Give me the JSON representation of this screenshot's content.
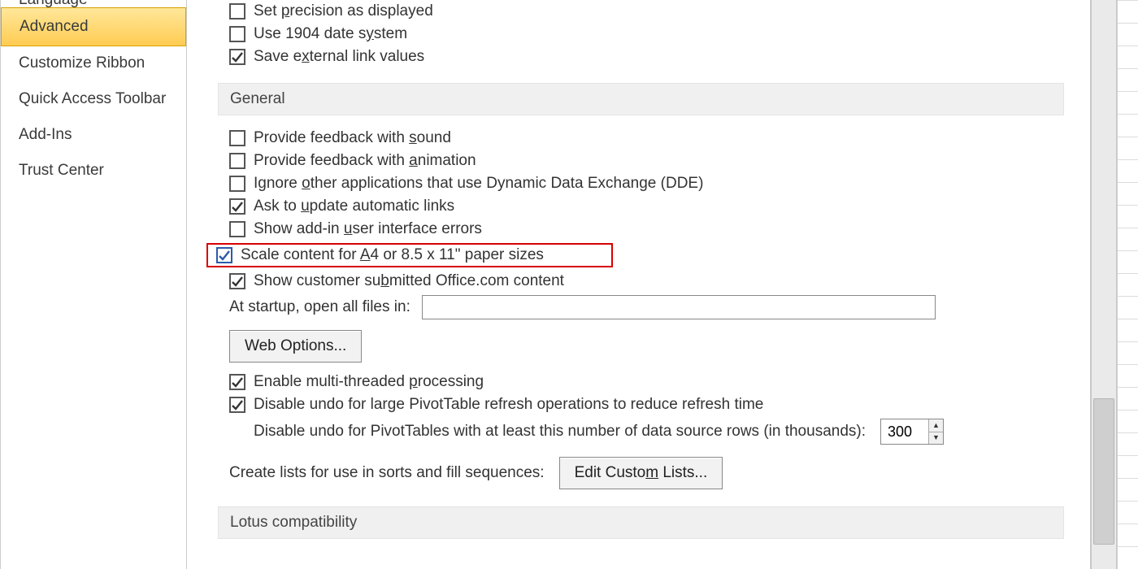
{
  "sidebar": {
    "items": [
      {
        "label": "Language",
        "active": false,
        "cut": true
      },
      {
        "label": "Advanced",
        "active": true
      },
      {
        "label": "Customize Ribbon",
        "active": false
      },
      {
        "label": "Quick Access Toolbar",
        "active": false
      },
      {
        "label": "Add-Ins",
        "active": false
      },
      {
        "label": "Trust Center",
        "active": false
      }
    ]
  },
  "top_section": {
    "options": [
      {
        "id": "precision",
        "checked": false,
        "pre": "Set ",
        "akey": "p",
        "post": "recision as displayed"
      },
      {
        "id": "date1904",
        "checked": false,
        "pre": "Use 1904 date s",
        "akey": "y",
        "post": "stem"
      },
      {
        "id": "extlinks",
        "checked": true,
        "pre": "Save e",
        "akey": "x",
        "post": "ternal link values"
      }
    ]
  },
  "general": {
    "header": "General",
    "options": [
      {
        "id": "sound",
        "checked": false,
        "pre": "Provide feedback with ",
        "akey": "s",
        "post": "ound"
      },
      {
        "id": "anim",
        "checked": false,
        "pre": "Provide feedback with ",
        "akey": "a",
        "post": "nimation"
      },
      {
        "id": "dde",
        "checked": false,
        "pre": "Ignore ",
        "akey": "o",
        "post": "ther applications that use Dynamic Data Exchange (DDE)"
      },
      {
        "id": "asklinks",
        "checked": true,
        "pre": "Ask to ",
        "akey": "u",
        "post": "pdate automatic links"
      },
      {
        "id": "addinui",
        "checked": false,
        "pre": "Show add-in ",
        "akey": "u",
        "post": "ser interface errors"
      },
      {
        "id": "scalea4",
        "checked": true,
        "highlight": true,
        "pre": "Scale content for ",
        "akey": "A",
        "post": "4 or 8.5 x 11\" paper sizes"
      },
      {
        "id": "officecom",
        "checked": true,
        "pre": "Show customer su",
        "akey": "b",
        "post": "mitted Office.com content"
      }
    ],
    "startup_label": "At startup, open all files in:",
    "startup_value": "",
    "web_options_btn": "Web Options...",
    "multithread": {
      "checked": true,
      "pre": "Enable multi-threaded ",
      "akey": "p",
      "post": "rocessing"
    },
    "disable_undo": {
      "checked": true,
      "pre": "Disable undo for lar",
      "akey": "g",
      "post": "e PivotTable refresh operations to reduce refresh time"
    },
    "undo_rows_label": "Disable undo for PivotTables with at least this number of data source rows (in thousands):",
    "undo_rows_value": "300",
    "create_lists_label": "Create lists for use in sorts and fill sequences:",
    "edit_lists_btn_pre": "Edit Custo",
    "edit_lists_btn_akey": "m",
    "edit_lists_btn_post": " Lists..."
  },
  "lotus": {
    "header": "Lotus compatibility"
  }
}
